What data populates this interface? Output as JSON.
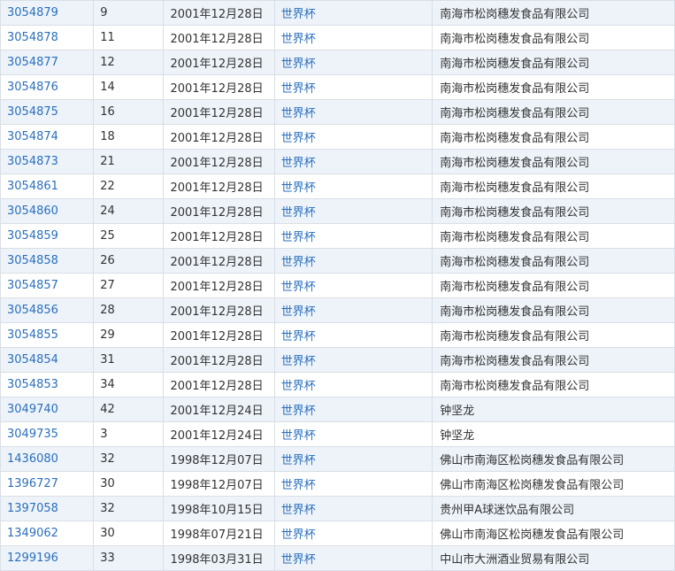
{
  "rows": [
    {
      "reg": "3054879",
      "cls": "9",
      "date": "2001年12月28日",
      "mark": "世界杯",
      "owner": "南海市松岗穗发食品有限公司"
    },
    {
      "reg": "3054878",
      "cls": "11",
      "date": "2001年12月28日",
      "mark": "世界杯",
      "owner": "南海市松岗穗发食品有限公司"
    },
    {
      "reg": "3054877",
      "cls": "12",
      "date": "2001年12月28日",
      "mark": "世界杯",
      "owner": "南海市松岗穗发食品有限公司"
    },
    {
      "reg": "3054876",
      "cls": "14",
      "date": "2001年12月28日",
      "mark": "世界杯",
      "owner": "南海市松岗穗发食品有限公司"
    },
    {
      "reg": "3054875",
      "cls": "16",
      "date": "2001年12月28日",
      "mark": "世界杯",
      "owner": "南海市松岗穗发食品有限公司"
    },
    {
      "reg": "3054874",
      "cls": "18",
      "date": "2001年12月28日",
      "mark": "世界杯",
      "owner": "南海市松岗穗发食品有限公司"
    },
    {
      "reg": "3054873",
      "cls": "21",
      "date": "2001年12月28日",
      "mark": "世界杯",
      "owner": "南海市松岗穗发食品有限公司"
    },
    {
      "reg": "3054861",
      "cls": "22",
      "date": "2001年12月28日",
      "mark": "世界杯",
      "owner": "南海市松岗穗发食品有限公司"
    },
    {
      "reg": "3054860",
      "cls": "24",
      "date": "2001年12月28日",
      "mark": "世界杯",
      "owner": "南海市松岗穗发食品有限公司"
    },
    {
      "reg": "3054859",
      "cls": "25",
      "date": "2001年12月28日",
      "mark": "世界杯",
      "owner": "南海市松岗穗发食品有限公司"
    },
    {
      "reg": "3054858",
      "cls": "26",
      "date": "2001年12月28日",
      "mark": "世界杯",
      "owner": "南海市松岗穗发食品有限公司"
    },
    {
      "reg": "3054857",
      "cls": "27",
      "date": "2001年12月28日",
      "mark": "世界杯",
      "owner": "南海市松岗穗发食品有限公司"
    },
    {
      "reg": "3054856",
      "cls": "28",
      "date": "2001年12月28日",
      "mark": "世界杯",
      "owner": "南海市松岗穗发食品有限公司"
    },
    {
      "reg": "3054855",
      "cls": "29",
      "date": "2001年12月28日",
      "mark": "世界杯",
      "owner": "南海市松岗穗发食品有限公司"
    },
    {
      "reg": "3054854",
      "cls": "31",
      "date": "2001年12月28日",
      "mark": "世界杯",
      "owner": "南海市松岗穗发食品有限公司"
    },
    {
      "reg": "3054853",
      "cls": "34",
      "date": "2001年12月28日",
      "mark": "世界杯",
      "owner": "南海市松岗穗发食品有限公司"
    },
    {
      "reg": "3049740",
      "cls": "42",
      "date": "2001年12月24日",
      "mark": "世界杯",
      "owner": "钟坚龙"
    },
    {
      "reg": "3049735",
      "cls": "3",
      "date": "2001年12月24日",
      "mark": "世界杯",
      "owner": "钟坚龙"
    },
    {
      "reg": "1436080",
      "cls": "32",
      "date": "1998年12月07日",
      "mark": "世界杯",
      "owner": "佛山市南海区松岗穗发食品有限公司"
    },
    {
      "reg": "1396727",
      "cls": "30",
      "date": "1998年12月07日",
      "mark": "世界杯",
      "owner": "佛山市南海区松岗穗发食品有限公司"
    },
    {
      "reg": "1397058",
      "cls": "32",
      "date": "1998年10月15日",
      "mark": "世界杯",
      "owner": "贵州甲A球迷饮品有限公司"
    },
    {
      "reg": "1349062",
      "cls": "30",
      "date": "1998年07月21日",
      "mark": "世界杯",
      "owner": "佛山市南海区松岗穗发食品有限公司"
    },
    {
      "reg": "1299196",
      "cls": "33",
      "date": "1998年03月31日",
      "mark": "世界杯",
      "owner": "中山市大洲酒业贸易有限公司"
    }
  ]
}
